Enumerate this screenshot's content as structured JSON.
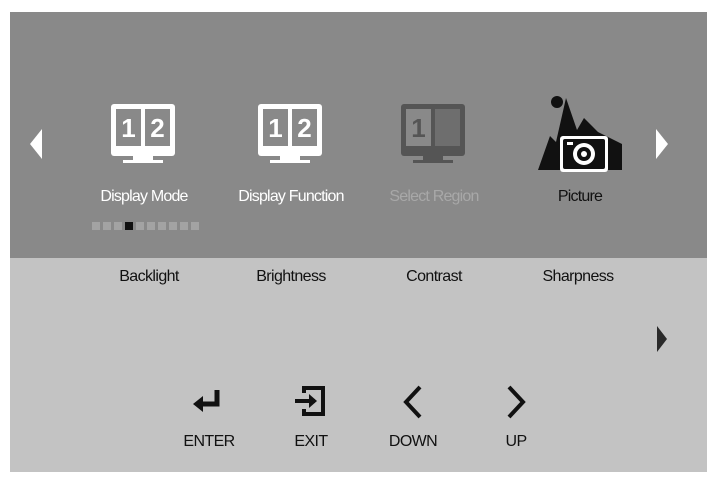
{
  "menu": {
    "items": [
      {
        "label": "Display Mode",
        "icon": "split-screen-icon",
        "state": "normal"
      },
      {
        "label": "Display Function",
        "icon": "split-screen-icon",
        "state": "normal"
      },
      {
        "label": "Select Region",
        "icon": "select-region-icon",
        "state": "disabled"
      },
      {
        "label": "Picture",
        "icon": "picture-icon",
        "state": "selected"
      }
    ],
    "icon_digits": [
      "1",
      "2"
    ],
    "page_count": 10,
    "current_page": 4
  },
  "settings": {
    "items": [
      {
        "label": "Backlight"
      },
      {
        "label": "Brightness"
      },
      {
        "label": "Contrast"
      },
      {
        "label": "Sharpness"
      }
    ]
  },
  "controls": [
    {
      "label": "ENTER",
      "icon": "enter-icon"
    },
    {
      "label": "EXIT",
      "icon": "exit-icon"
    },
    {
      "label": "DOWN",
      "icon": "chevron-left-icon"
    },
    {
      "label": "UP",
      "icon": "chevron-right-icon"
    }
  ],
  "colors": {
    "top_panel": "#898989",
    "bottom_panel": "#c3c3c3",
    "icon_active": "#ffffff",
    "icon_disabled": "#555555",
    "icon_selected": "#111111"
  }
}
